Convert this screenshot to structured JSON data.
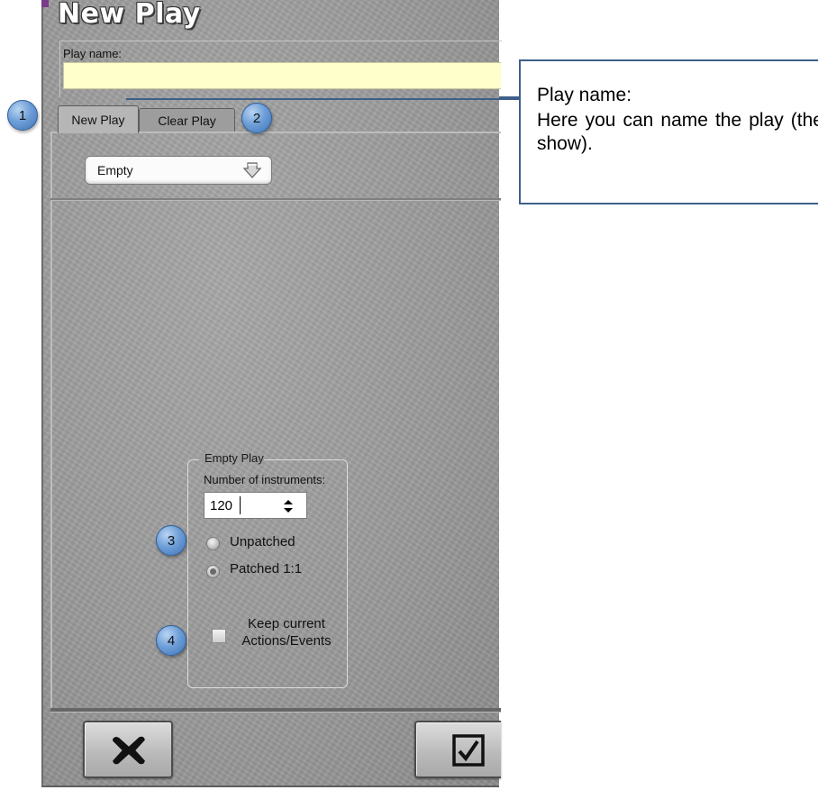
{
  "window": {
    "title": "New Play"
  },
  "play_name": {
    "label": "Play name:",
    "value": ""
  },
  "tabs": [
    {
      "label": "New Play",
      "selected": true
    },
    {
      "label": "Clear Play",
      "selected": false
    }
  ],
  "template_dropdown": {
    "selected": "Empty"
  },
  "empty_play_group": {
    "title": "Empty Play",
    "instruments_label": "Number of instruments:",
    "instruments_value": "120",
    "patch_options": [
      {
        "label": "Unpatched",
        "selected": false
      },
      {
        "label": "Patched 1:1",
        "selected": true
      }
    ],
    "keep_checkbox": {
      "label": "Keep current Actions/Events",
      "checked": false
    }
  },
  "buttons": {
    "cancel_icon": "x-icon",
    "ok_icon": "checkbox-check-icon"
  },
  "markers": [
    "1",
    "2",
    "3",
    "4"
  ],
  "callout": {
    "title": "Play name:",
    "body": "Here you can name the play (the show)."
  },
  "colors": {
    "marker_blue": "#6f9fd8",
    "input_yellow": "#ffffcc",
    "callout_border": "#3e5f8a"
  }
}
